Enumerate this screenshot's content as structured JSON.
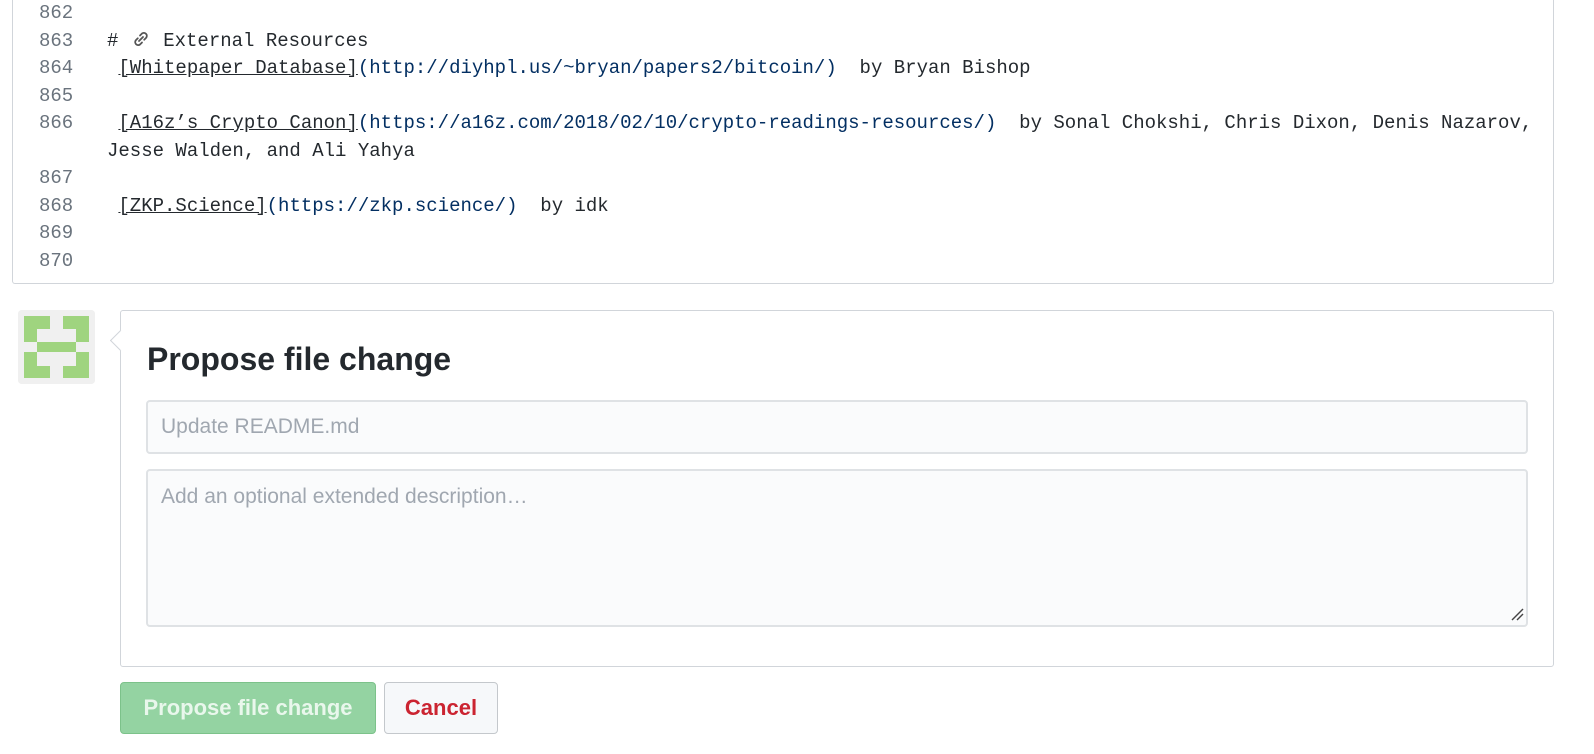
{
  "editor": {
    "lines": [
      {
        "number": "862",
        "segments": []
      },
      {
        "number": "863",
        "heading_prefix": "# ",
        "heading_text": " External Resources",
        "link_icon": "link-icon"
      },
      {
        "number": "864",
        "pre": " ",
        "link_text": "[Whitepaper Database]",
        "url": "(http://diyhpl.us/~bryan/papers2/bitcoin/)",
        "post": "  by Bryan Bishop"
      },
      {
        "number": "865"
      },
      {
        "number": "866",
        "pre": " ",
        "link_text": "[A16z’s Crypto Canon]",
        "url": "(https://a16z.com/2018/02/10/crypto-readings-resources/)",
        "post": "  by Sonal Chokshi, Chris Dixon, Denis Nazarov, Jesse Walden, and Ali Yahya"
      },
      {
        "number": "867"
      },
      {
        "number": "868",
        "pre": " ",
        "link_text": "[ZKP.Science]",
        "url": "(https://zkp.science/)",
        "post": "  by idk"
      },
      {
        "number": "869"
      },
      {
        "number": "870"
      }
    ]
  },
  "commit": {
    "title": "Propose file change",
    "summary_placeholder": "Update README.md",
    "description_placeholder": "Add an optional extended description…"
  },
  "buttons": {
    "propose_label": "Propose file change",
    "cancel_label": "Cancel"
  },
  "colors": {
    "url": "#032f62",
    "primary_button": "#94d3a2",
    "cancel_text": "#cb2431",
    "avatar": "#9fd47f"
  }
}
